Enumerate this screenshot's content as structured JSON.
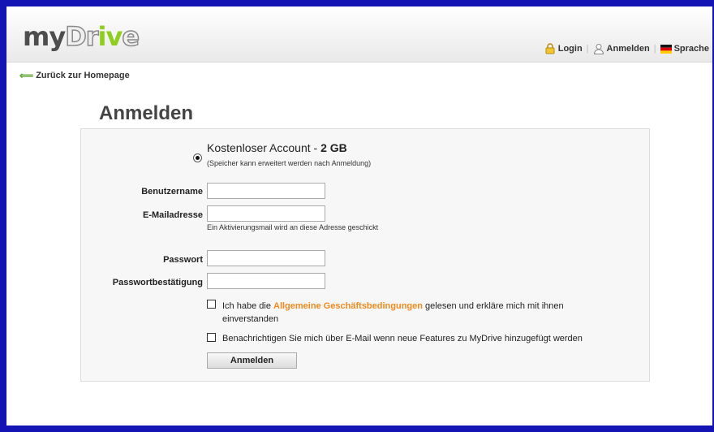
{
  "header": {
    "logo": {
      "part1": "my",
      "part2": "Dr",
      "part3": "iv",
      "part4": "e"
    },
    "nav": {
      "login": "Login",
      "anmelden": "Anmelden",
      "sprache": "Sprache",
      "separator": "|"
    }
  },
  "back_link": "Zurück zur Homepage",
  "page_title": "Anmelden",
  "form": {
    "plan_name": "Kostenloser Account - ",
    "plan_size": "2 GB",
    "plan_note": "(Speicher kann erweitert werden nach Anmeldung)",
    "username_label": "Benutzername",
    "username_value": "",
    "email_label": "E-Mailadresse",
    "email_value": "",
    "email_hint": "Ein Aktivierungsmail wird an diese Adresse geschickt",
    "password_label": "Passwort",
    "password_value": "",
    "password_confirm_label": "Passwortbestätigung",
    "password_confirm_value": "",
    "terms_before": "Ich habe die ",
    "terms_link": "Allgemeine Geschäftsbedingungen",
    "terms_after": " gelesen und erkläre mich mit ihnen",
    "terms_line2": "einverstanden",
    "newsletter": "Benachrichtigen Sie mich über E-Mail wenn neue Features zu MyDrive hinzugefügt werden",
    "submit_label": "Anmelden"
  },
  "colors": {
    "frame": "#1414b4",
    "accent_link": "#f08a1c",
    "logo_green": "#8fce1c"
  }
}
